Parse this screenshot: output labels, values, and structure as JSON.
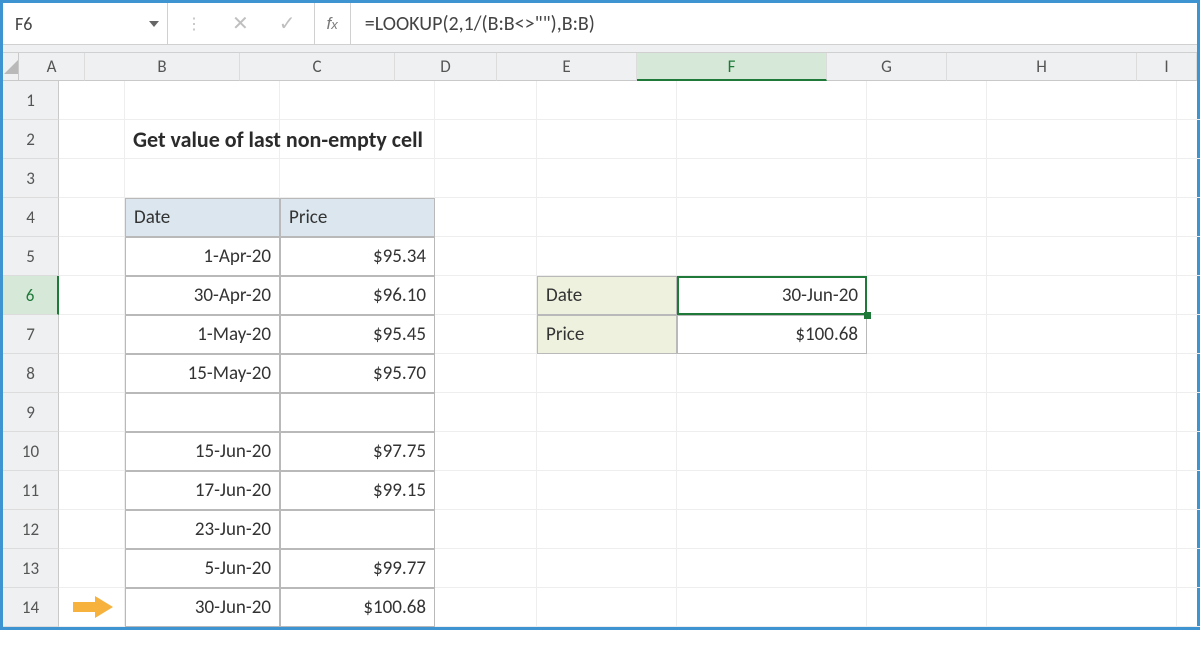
{
  "activeCell": "F6",
  "formula": "=LOOKUP(2,1/(B:B<>\"\"),B:B)",
  "title": "Get value of last non-empty cell",
  "columns": [
    "A",
    "B",
    "C",
    "D",
    "E",
    "F",
    "G",
    "H",
    "I"
  ],
  "rows": [
    "1",
    "2",
    "3",
    "4",
    "5",
    "6",
    "7",
    "8",
    "9",
    "10",
    "11",
    "12",
    "13",
    "14"
  ],
  "table": {
    "headers": {
      "b": "Date",
      "c": "Price"
    },
    "rows": [
      {
        "date": "1-Apr-20",
        "price": "$95.34"
      },
      {
        "date": "30-Apr-20",
        "price": "$96.10"
      },
      {
        "date": "1-May-20",
        "price": "$95.45"
      },
      {
        "date": "15-May-20",
        "price": "$95.70"
      },
      {
        "date": "",
        "price": ""
      },
      {
        "date": "15-Jun-20",
        "price": "$97.75"
      },
      {
        "date": "17-Jun-20",
        "price": "$99.15"
      },
      {
        "date": "23-Jun-20",
        "price": ""
      },
      {
        "date": "5-Jun-20",
        "price": "$99.77"
      },
      {
        "date": "30-Jun-20",
        "price": "$100.68"
      }
    ]
  },
  "lookup": {
    "dateLabel": "Date",
    "dateValue": "30-Jun-20",
    "priceLabel": "Price",
    "priceValue": "$100.68"
  }
}
